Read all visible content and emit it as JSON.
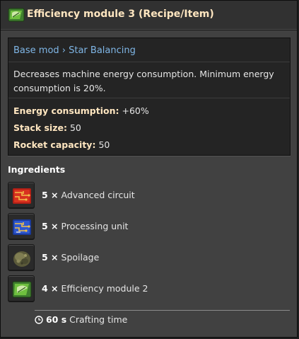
{
  "title": "Efficiency module 3 (Recipe/Item)",
  "breadcrumb": "Base mod › Star Balancing",
  "description": "Decreases machine energy consumption. Minimum energy consumption is 20%.",
  "properties": [
    {
      "label": "Energy consumption:",
      "value": "+60%"
    },
    {
      "label": "Stack size:",
      "value": "50"
    },
    {
      "label": "Rocket capacity:",
      "value": "50"
    }
  ],
  "ingredients_title": "Ingredients",
  "ingredients": [
    {
      "amount": "5 ×",
      "name": "Advanced circuit",
      "icon": "advanced-circuit-icon"
    },
    {
      "amount": "5 ×",
      "name": "Processing unit",
      "icon": "processing-unit-icon"
    },
    {
      "amount": "5 ×",
      "name": "Spoilage",
      "icon": "spoilage-icon"
    },
    {
      "amount": "4 ×",
      "name": "Efficiency module 2",
      "icon": "efficiency-module-icon"
    }
  ],
  "crafting": {
    "time": "60 s",
    "label": "Crafting time"
  },
  "colors": {
    "title": "#ffe6c0",
    "link": "#7fb6e6",
    "panel": "#414141",
    "info_bg": "#242424"
  }
}
